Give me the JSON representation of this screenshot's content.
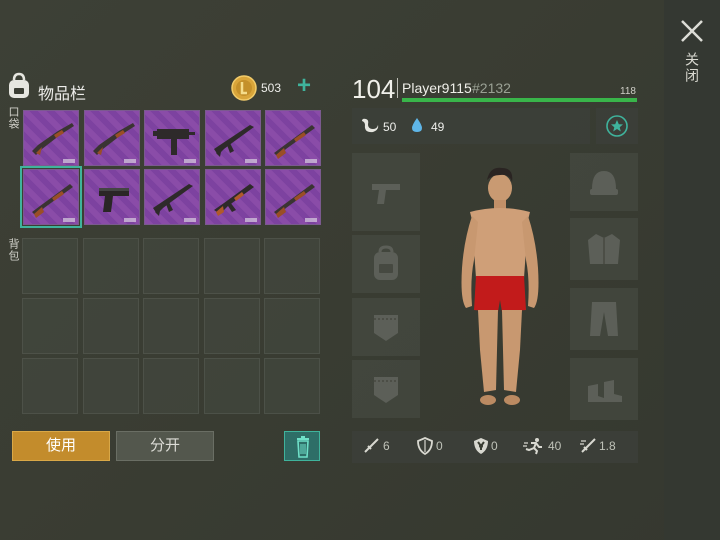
{
  "close": {
    "label": "关闭"
  },
  "inventory": {
    "title": "物品栏",
    "coins": "503",
    "pocket_label": "口袋",
    "backpack_label": "背包",
    "pocket_slots": [
      {
        "item": "shotgun-icon"
      },
      {
        "item": "shotgun-icon"
      },
      {
        "item": "uzi-icon"
      },
      {
        "item": "assault-rifle-icon"
      },
      {
        "item": "rifle-icon"
      },
      {
        "item": "rifle-icon",
        "selected": true
      },
      {
        "item": "pistol-icon"
      },
      {
        "item": "assault-rifle-icon"
      },
      {
        "item": "ak-rifle-icon"
      },
      {
        "item": "rifle-icon"
      }
    ],
    "use_label": "使用",
    "split_label": "分开"
  },
  "character": {
    "level": "104",
    "name": "Player9115",
    "id": "#2132",
    "xp_value": "118",
    "xp_fraction": 1.0,
    "hunger": "50",
    "thirst": "49",
    "left_slots": [
      "pistol-icon",
      "backpack-icon",
      "pocket-icon",
      "pocket-icon"
    ],
    "right_slots": [
      "hat-icon",
      "jacket-icon",
      "pants-icon",
      "boots-icon"
    ],
    "stats": {
      "attack": "6",
      "defense": "0",
      "radiation": "0",
      "speed": "40",
      "attack_speed": "1.8"
    }
  },
  "colors": {
    "accent": "#3fb39c",
    "xp": "#39b54a",
    "use_button": "#c38c2c",
    "rarity": "#8a4ca8"
  }
}
